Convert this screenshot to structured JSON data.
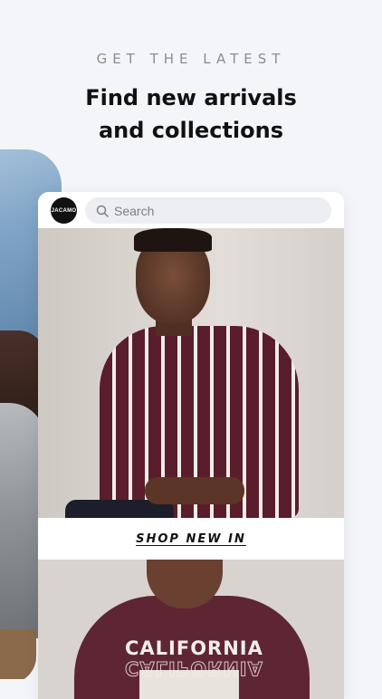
{
  "header": {
    "eyebrow": "GET THE LATEST",
    "headline_line1": "Find new arrivals",
    "headline_line2": "and collections"
  },
  "app": {
    "logo_text": "JACAMO",
    "search": {
      "placeholder": "Search",
      "icon": "search-icon"
    }
  },
  "cards": [
    {
      "cta_label": "SHOP NEW IN"
    },
    {
      "print_text": "CALIFORNIA"
    }
  ],
  "colors": {
    "background": "#f4f5f9",
    "shirt_stripe": "#5a1d2c",
    "tee": "#5e2632"
  }
}
